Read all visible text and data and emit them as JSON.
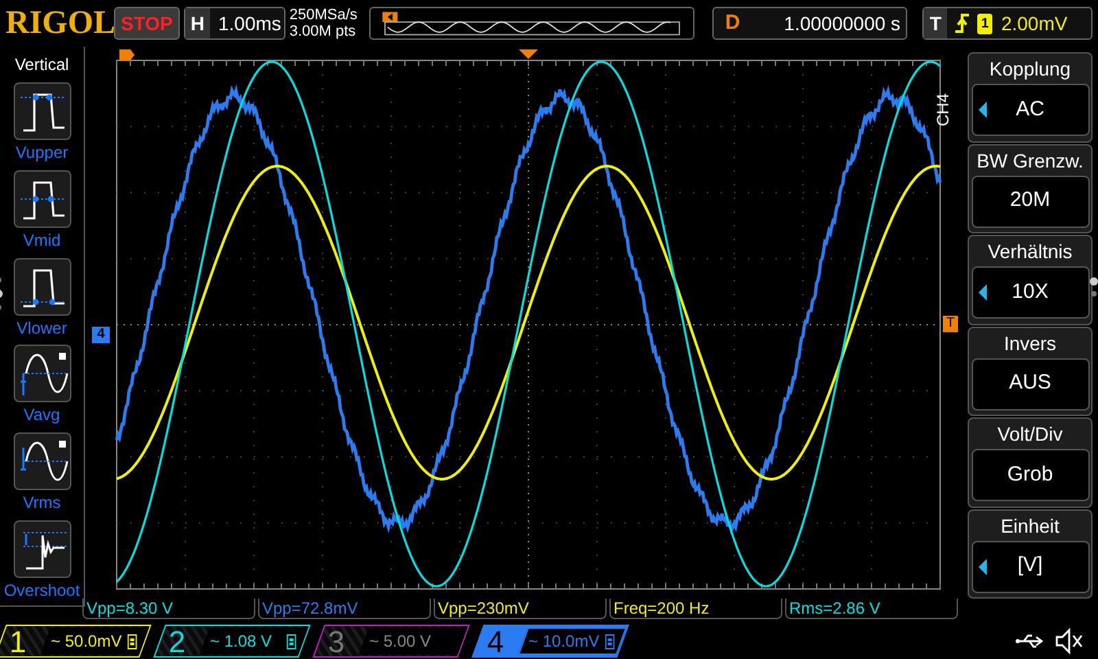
{
  "header": {
    "logo": "RIGOL",
    "run_state": "STOP",
    "timebase": {
      "label": "H",
      "value": "1.00ms"
    },
    "sample_rate": "250MSa/s",
    "memory_depth": "3.00M pts",
    "delay": {
      "label": "D",
      "value": "1.00000000 s"
    },
    "trigger": {
      "label": "T",
      "source": "1",
      "level": "2.00mV"
    }
  },
  "left_menu": {
    "title": "Vertical",
    "items": [
      {
        "label": "Vupper",
        "kind": "upper"
      },
      {
        "label": "Vmid",
        "kind": "mid"
      },
      {
        "label": "Vlower",
        "kind": "lower"
      },
      {
        "label": "Vavg",
        "kind": "avg"
      },
      {
        "label": "Vrms",
        "kind": "rms"
      },
      {
        "label": "Overshoot",
        "kind": "overshoot"
      }
    ]
  },
  "plot": {
    "channel_marker": "4",
    "trigger_level_marker": "T"
  },
  "right_menu": {
    "channel_label": "CH4",
    "items": [
      {
        "title": "Kopplung",
        "value": "AC",
        "adjustable": true
      },
      {
        "title": "BW Grenzw.",
        "value": "20M",
        "adjustable": false
      },
      {
        "title": "Verhältnis",
        "value": "10X",
        "adjustable": true
      },
      {
        "title": "Invers",
        "value": "AUS",
        "adjustable": false
      },
      {
        "title": "Volt/Div",
        "value": "Grob",
        "adjustable": false
      },
      {
        "title": "Einheit",
        "value": "[V]",
        "adjustable": true
      }
    ]
  },
  "measurements": [
    {
      "text": "Vpp=8.30 V",
      "color": "#00e0e0"
    },
    {
      "text": "Vpp=72.8mV",
      "color": "#2a7cf0"
    },
    {
      "text": "Vpp=230mV",
      "color": "#f0f000"
    },
    {
      "text": "Freq=200 Hz",
      "color": "#f0f000"
    },
    {
      "text": "Rms=2.86 V",
      "color": "#00e0e0"
    }
  ],
  "channels": [
    {
      "number": "1",
      "coupling": "~",
      "scale": "50.0mV",
      "enabled": true,
      "selected": false,
      "color": "#f0f000"
    },
    {
      "number": "2",
      "coupling": "~",
      "scale": "1.08 V",
      "enabled": true,
      "selected": false,
      "color": "#00e0e0"
    },
    {
      "number": "3",
      "coupling": "~",
      "scale": "5.00 V",
      "enabled": false,
      "selected": false,
      "color": "#c020c0"
    },
    {
      "number": "4",
      "coupling": "~",
      "scale": "10.0mV",
      "enabled": true,
      "selected": true,
      "color": "#2a7cf0"
    }
  ]
}
